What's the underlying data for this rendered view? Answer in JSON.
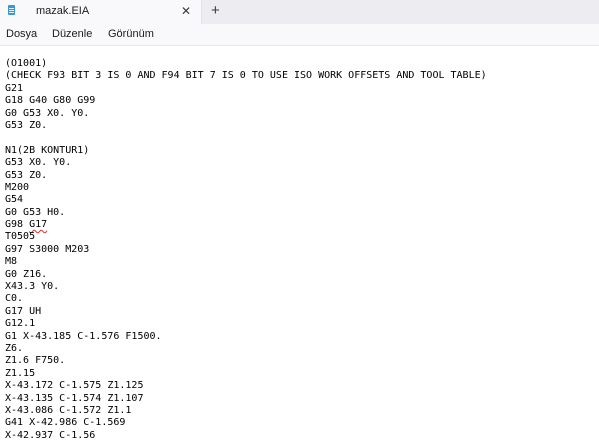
{
  "window": {
    "tab_title": "mazak.EIA",
    "tab_close_glyph": "✕",
    "new_tab_glyph": "+",
    "icons": [
      "notepad-app-icon",
      "close-icon",
      "plus-icon"
    ]
  },
  "menu": {
    "items": [
      "Dosya",
      "Düzenle",
      "Görünüm"
    ]
  },
  "editor": {
    "lines": [
      "(O1001)",
      "(CHECK F93 BIT 3 IS 0 AND F94 BIT 7 IS 0 TO USE ISO WORK OFFSETS AND TOOL TABLE)",
      "G21",
      "G18 G40 G80 G99",
      "G0 G53 X0. Y0.",
      "G53 Z0.",
      "",
      "N1(2B KONTUR1)",
      "G53 X0. Y0.",
      "G53 Z0.",
      "M200",
      "G54",
      "G0 G53 H0.",
      "G98 G17",
      "T0505",
      "G97 S3000 M203",
      "M8",
      "G0 Z16.",
      "X43.3 Y0.",
      "C0.",
      "G17 UH",
      "G12.1",
      "G1 X-43.185 C-1.576 F1500.",
      "Z6.",
      "Z1.6 F750.",
      "Z1.15",
      "X-43.172 C-1.575 Z1.125",
      "X-43.135 C-1.574 Z1.107",
      "X-43.086 C-1.572 Z1.1",
      "G41 X-42.986 C-1.569",
      "X-42.937 C-1.56"
    ],
    "spellcheck_word": "G17",
    "spellcheck_line_index": 13,
    "spellcheck_color": "#d92c2c"
  }
}
